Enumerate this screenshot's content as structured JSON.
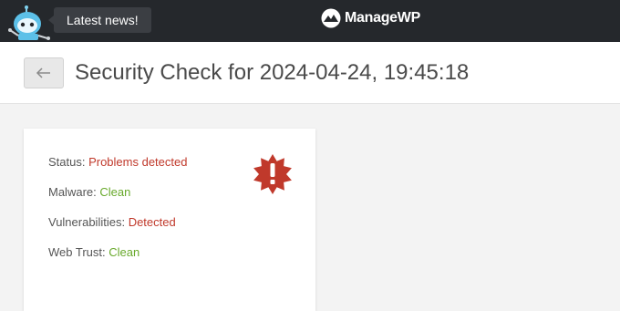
{
  "topbar": {
    "tooltip": "Latest news!",
    "brand": "ManageWP",
    "mascot_icon": "robot-mascot-icon",
    "brand_icon": "managewp-logo-icon",
    "background": "#25282c"
  },
  "header": {
    "back_icon": "arrow-left-icon",
    "title": "Security Check for 2024-04-24, 19:45:18"
  },
  "report": {
    "alert_icon": "warning-burst-icon",
    "alert_color": "#c0392b",
    "rows": [
      {
        "label": "Status: ",
        "value": "Problems detected",
        "state": "bad"
      },
      {
        "label": "Malware: ",
        "value": "Clean",
        "state": "good"
      },
      {
        "label": "Vulnerabilities: ",
        "value": "Detected",
        "state": "bad"
      },
      {
        "label": "Web Trust: ",
        "value": "Clean",
        "state": "good"
      }
    ]
  },
  "colors": {
    "bad": "#c0392b",
    "good": "#68a92b"
  }
}
